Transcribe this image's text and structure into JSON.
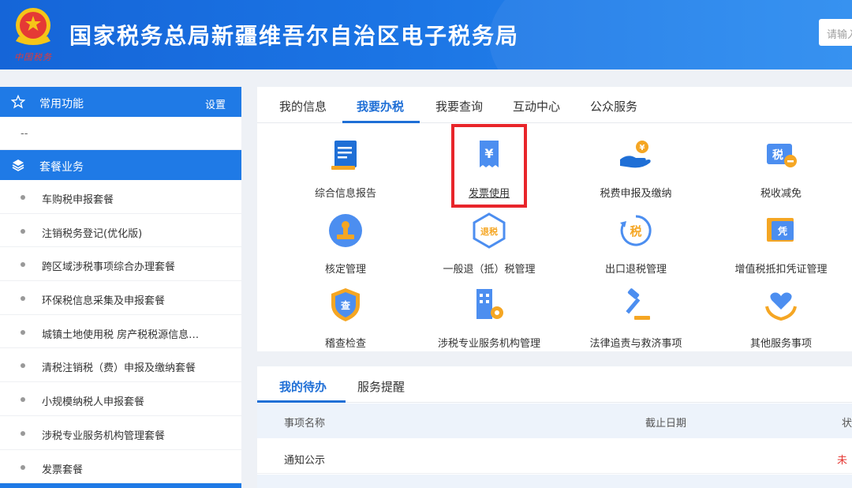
{
  "header": {
    "title": "国家税务总局新疆维吾尔自治区电子税务局",
    "emblem_caption": "中国税务",
    "search_placeholder": "请输入"
  },
  "sidebar": {
    "common": {
      "label": "常用功能",
      "setting": "设置",
      "placeholder": "--"
    },
    "package": {
      "label": "套餐业务",
      "items": [
        "车购税申报套餐",
        "注销税务登记(优化版)",
        "跨区域涉税事项综合办理套餐",
        "环保税信息采集及申报套餐",
        "城镇土地使用税 房产税税源信息…",
        "清税注销税（费）申报及缴纳套餐",
        "小规模纳税人申报套餐",
        "涉税专业服务机构管理套餐",
        "发票套餐"
      ]
    }
  },
  "main": {
    "tabs": [
      "我的信息",
      "我要办税",
      "我要查询",
      "互动中心",
      "公众服务"
    ],
    "active_tab": "我要办税",
    "services": [
      {
        "label": "综合信息报告",
        "icon": "document-report-icon"
      },
      {
        "label": "发票使用",
        "icon": "invoice-yen-icon",
        "icon_text": "¥"
      },
      {
        "label": "税费申报及缴纳",
        "icon": "hand-coin-icon",
        "icon_text": "¥"
      },
      {
        "label": "税收减免",
        "icon": "tax-minus-icon",
        "icon_text": "税"
      },
      {
        "label": "核定管理",
        "icon": "stamp-icon"
      },
      {
        "label": "一般退（抵）税管理",
        "icon": "tax-refund-icon",
        "icon_text": "退税"
      },
      {
        "label": "出口退税管理",
        "icon": "export-refund-icon",
        "icon_text": "税"
      },
      {
        "label": "增值税抵扣凭证管理",
        "icon": "voucher-icon",
        "icon_text": "凭"
      },
      {
        "label": "稽查检查",
        "icon": "inspection-shield-icon",
        "icon_text": "查"
      },
      {
        "label": "涉税专业服务机构管理",
        "icon": "building-gear-icon"
      },
      {
        "label": "法律追责与救济事项",
        "icon": "gavel-icon"
      },
      {
        "label": "其他服务事项",
        "icon": "heart-hands-icon"
      }
    ]
  },
  "todo": {
    "tabs": [
      "我的待办",
      "服务提醒"
    ],
    "columns": [
      "事项名称",
      "截止日期",
      "状"
    ],
    "rows": [
      {
        "name": "通知公示",
        "status": "未"
      }
    ]
  },
  "colors": {
    "primary": "#1f6fd6",
    "highlight": "#e8252a",
    "icon_orange": "#f5a623"
  }
}
